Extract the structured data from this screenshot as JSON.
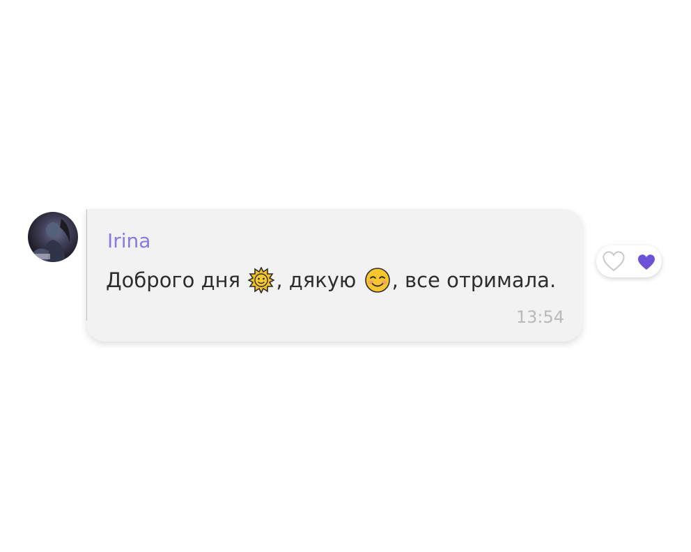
{
  "message": {
    "sender": "Irina",
    "text_parts": [
      "Доброго дня ",
      ", дякую ",
      ", все отримала."
    ],
    "emojis": [
      "sun-with-face-icon",
      "smiling-face-icon"
    ],
    "time": "13:54"
  },
  "reactions": {
    "items": [
      "heart-outline-icon",
      "heart-filled-icon"
    ],
    "accent_color": "#6b52d6"
  },
  "colors": {
    "sender_name": "#8b78e0",
    "bubble_bg": "#f2f2f2",
    "message_text": "#2d2d2d",
    "timestamp": "#b9b9b9"
  }
}
